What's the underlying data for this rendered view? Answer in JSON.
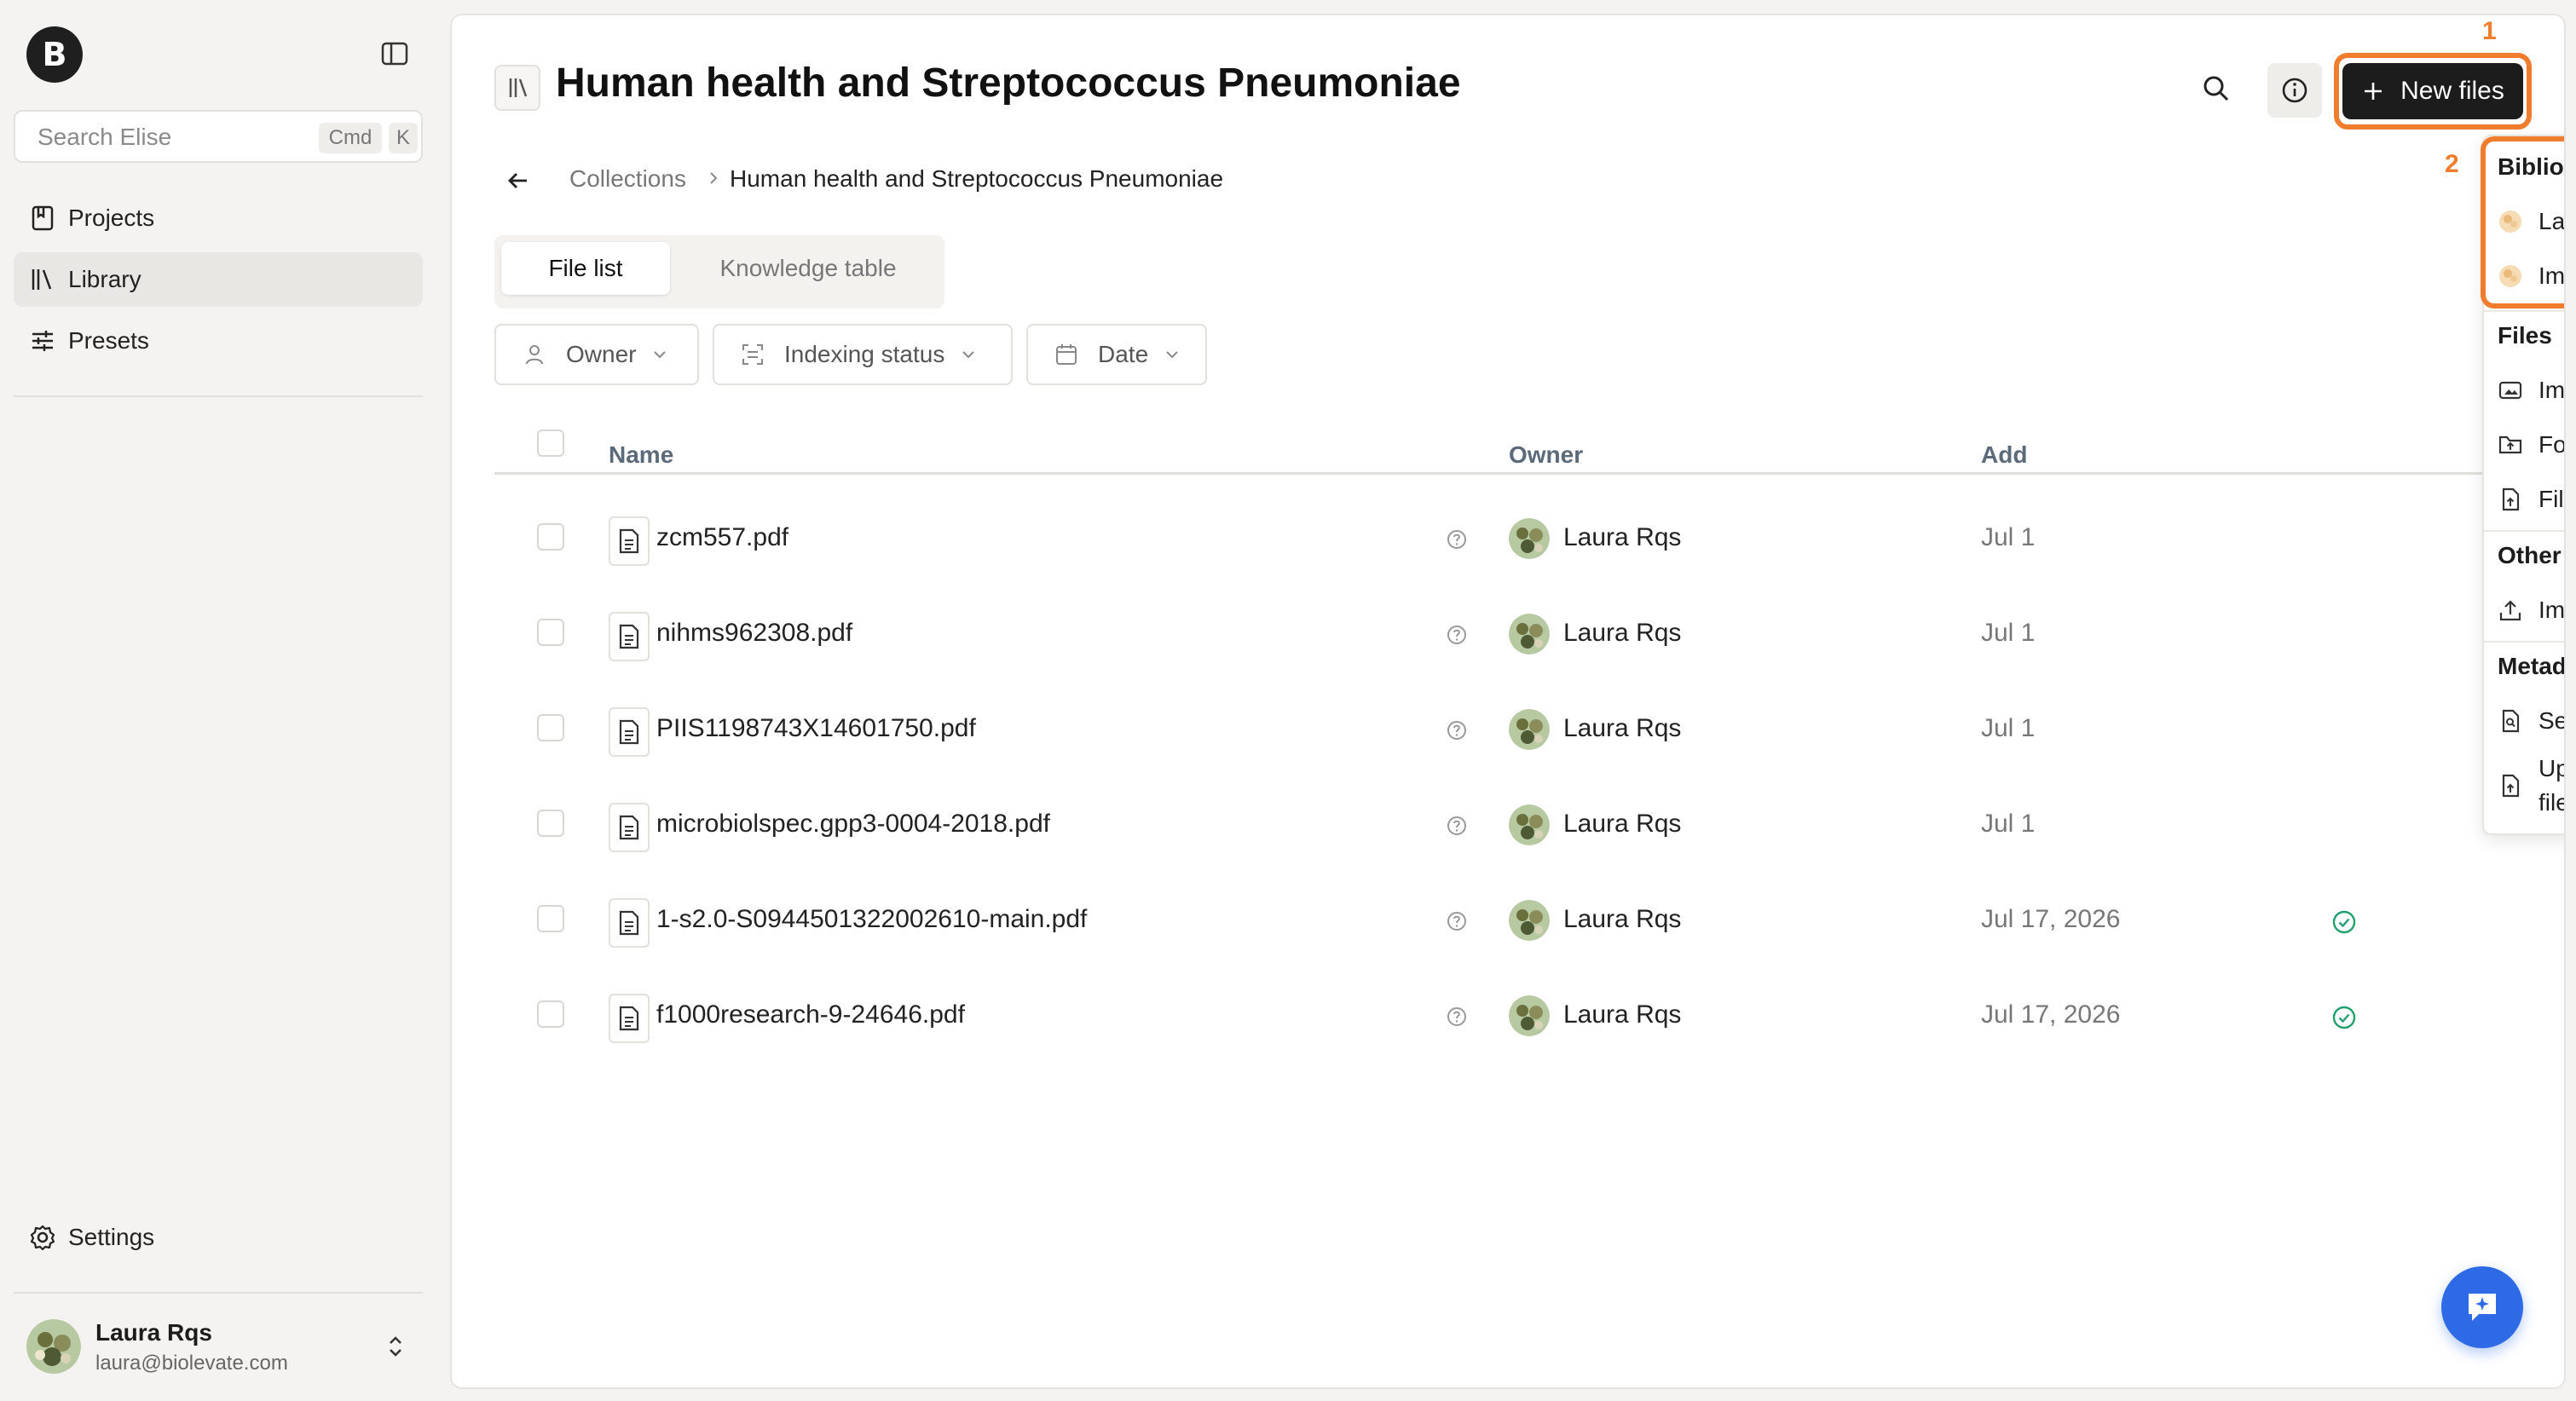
{
  "sidebar": {
    "logo_letter": "B",
    "search": {
      "placeholder": "Search Elise",
      "shortcut_mod": "Cmd",
      "shortcut_key": "K"
    },
    "items": [
      {
        "label": "Projects",
        "icon": "book-icon"
      },
      {
        "label": "Library",
        "icon": "library-icon",
        "active": true
      },
      {
        "label": "Presets",
        "icon": "sliders-icon"
      }
    ],
    "settings_label": "Settings",
    "user": {
      "name": "Laura Rqs",
      "email": "laura@biolevate.com"
    }
  },
  "header": {
    "title": "Human health and Streptococcus Pneumoniae",
    "new_files_label": "New files"
  },
  "breadcrumb": {
    "parent": "Collections",
    "current": "Human health and Streptococcus Pneumoniae"
  },
  "tabs": [
    {
      "label": "File list",
      "active": true
    },
    {
      "label": "Knowledge table",
      "active": false
    }
  ],
  "filters": {
    "owner": "Owner",
    "indexing_status": "Indexing status",
    "date": "Date"
  },
  "table": {
    "columns": {
      "name": "Name",
      "owner": "Owner",
      "added": "Add"
    },
    "rows": [
      {
        "name": "zcm557.pdf",
        "owner": "Laura Rqs",
        "date": "Jul 1",
        "status": ""
      },
      {
        "name": "nihms962308.pdf",
        "owner": "Laura Rqs",
        "date": "Jul 1",
        "status": ""
      },
      {
        "name": "PIIS1198743X14601750.pdf",
        "owner": "Laura Rqs",
        "date": "Jul 1",
        "status": ""
      },
      {
        "name": "microbiolspec.gpp3-0004-2018.pdf",
        "owner": "Laura Rqs",
        "date": "Jul 1",
        "status": ""
      },
      {
        "name": "1-s2.0-S0944501322002610-main.pdf",
        "owner": "Laura Rqs",
        "date": "Jul 17, 2026",
        "status": "check"
      },
      {
        "name": "f1000research-9-24646.pdf",
        "owner": "Laura Rqs",
        "date": "Jul 17, 2026",
        "status": "check"
      }
    ]
  },
  "dropdown": {
    "bibliosearch": {
      "heading": "Bibliosearch",
      "items": [
        "Launch new search",
        "Import files from saved search"
      ]
    },
    "files": {
      "heading": "Files",
      "items": [
        "Import from repository",
        "Folder upload",
        "File upload"
      ]
    },
    "other": {
      "heading": "Other",
      "items": [
        "Import references"
      ]
    },
    "metadata": {
      "heading": "Metadata files",
      "items": [
        "Search and get available files",
        "Upload and merge with metadata files"
      ]
    }
  },
  "annotations": {
    "first": "1",
    "second": "2"
  },
  "colors": {
    "accent": "#ef7d2d",
    "primary_button": "#1c1c1c",
    "fab": "#2f6ae6",
    "success": "#22a06b"
  }
}
